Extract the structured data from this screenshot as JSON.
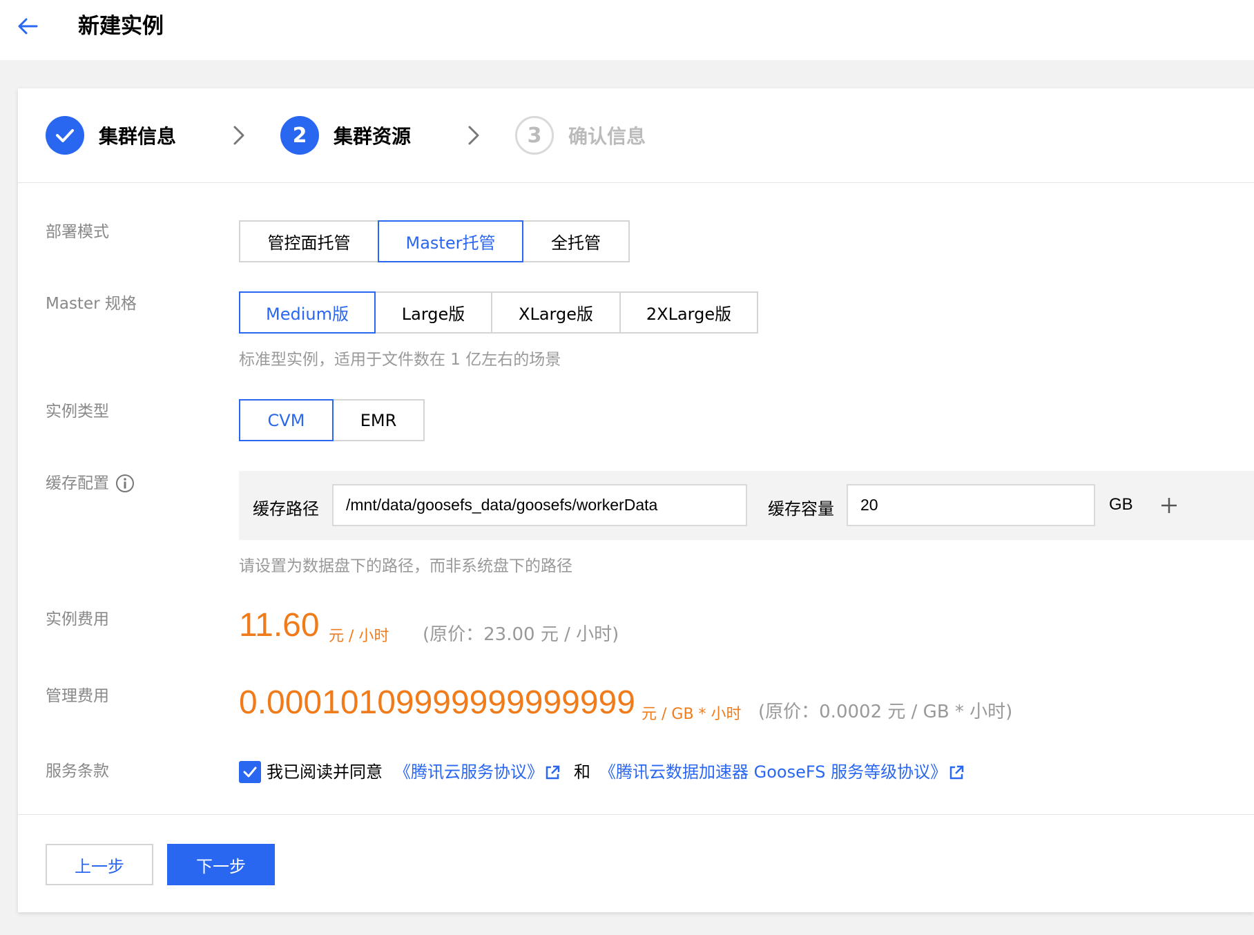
{
  "header": {
    "back_icon": "arrow-left-icon",
    "title": "新建实例"
  },
  "steps": [
    {
      "label": "集群信息",
      "status": "done",
      "indicator": ""
    },
    {
      "label": "集群资源",
      "status": "active",
      "indicator": "2"
    },
    {
      "label": "确认信息",
      "status": "pending",
      "indicator": "3"
    }
  ],
  "form": {
    "deploy_mode": {
      "label": "部署模式",
      "options": [
        "管控面托管",
        "Master托管",
        "全托管"
      ],
      "selected": "Master托管"
    },
    "master_spec": {
      "label": "Master 规格",
      "options": [
        "Medium版",
        "Large版",
        "XLarge版",
        "2XLarge版"
      ],
      "selected": "Medium版",
      "hint": "标准型实例，适用于文件数在 1 亿左右的场景"
    },
    "instance_type": {
      "label": "实例类型",
      "options": [
        "CVM",
        "EMR"
      ],
      "selected": "CVM"
    },
    "cache": {
      "label": "缓存配置",
      "path_label": "缓存路径",
      "path_value": "/mnt/data/goosefs_data/goosefs/workerData",
      "capacity_label": "缓存容量",
      "capacity_value": "20",
      "capacity_unit": "GB",
      "hint": "请设置为数据盘下的路径，而非系统盘下的路径"
    },
    "instance_fee": {
      "label": "实例费用",
      "price": "11.60",
      "unit": "元 / 小时",
      "original": "(原价：23.00 元 / 小时)"
    },
    "management_fee": {
      "label": "管理费用",
      "price": "0.00010109999999999999",
      "unit": "元 / GB * 小时",
      "original": "(原价：0.0002 元 / GB * 小时)"
    },
    "terms": {
      "label": "服务条款",
      "checked": true,
      "agree_text": "我已阅读并同意",
      "link1": "《腾讯云服务协议》",
      "and_text": "和",
      "link2": "《腾讯云数据加速器 GooseFS 服务等级协议》"
    }
  },
  "buttons": {
    "prev": "上一步",
    "next": "下一步"
  },
  "colors": {
    "primary": "#2a67f0",
    "price": "#f07b1a"
  }
}
